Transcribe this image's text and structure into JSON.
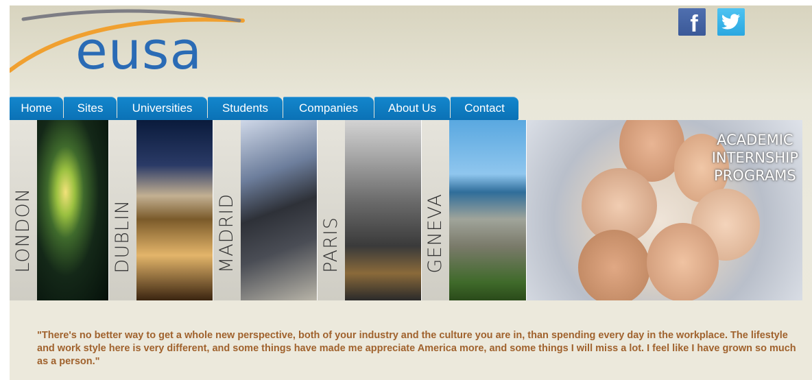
{
  "brand": {
    "logo_text": "eusa",
    "blue": "#2a6bb5",
    "orange": "#f0a030"
  },
  "social": {
    "facebook_label": "f",
    "twitter_icon": "twitter-bird-icon"
  },
  "nav": {
    "items": [
      {
        "label": "Home"
      },
      {
        "label": "Sites"
      },
      {
        "label": "Universities"
      },
      {
        "label": "Students"
      },
      {
        "label": "Companies"
      },
      {
        "label": "About Us"
      },
      {
        "label": "Contact"
      }
    ],
    "color": "#0b72b6"
  },
  "banner": {
    "cities": [
      "LONDON",
      "DUBLIN",
      "MADRID",
      "PARIS",
      "GENEVA"
    ],
    "program_lines": [
      "ACADEMIC",
      "INTERNSHIP",
      "PROGRAMS"
    ]
  },
  "quote": {
    "text": "\"There's no better way to get a whole new perspective, both of your industry and the culture you are in, than spending every day in the workplace. The lifestyle and work style here is very different, and some things have made me appreciate America more, and some things I will miss a lot. I feel like I have grown so much as a person.\"",
    "color": "#a0622d"
  }
}
